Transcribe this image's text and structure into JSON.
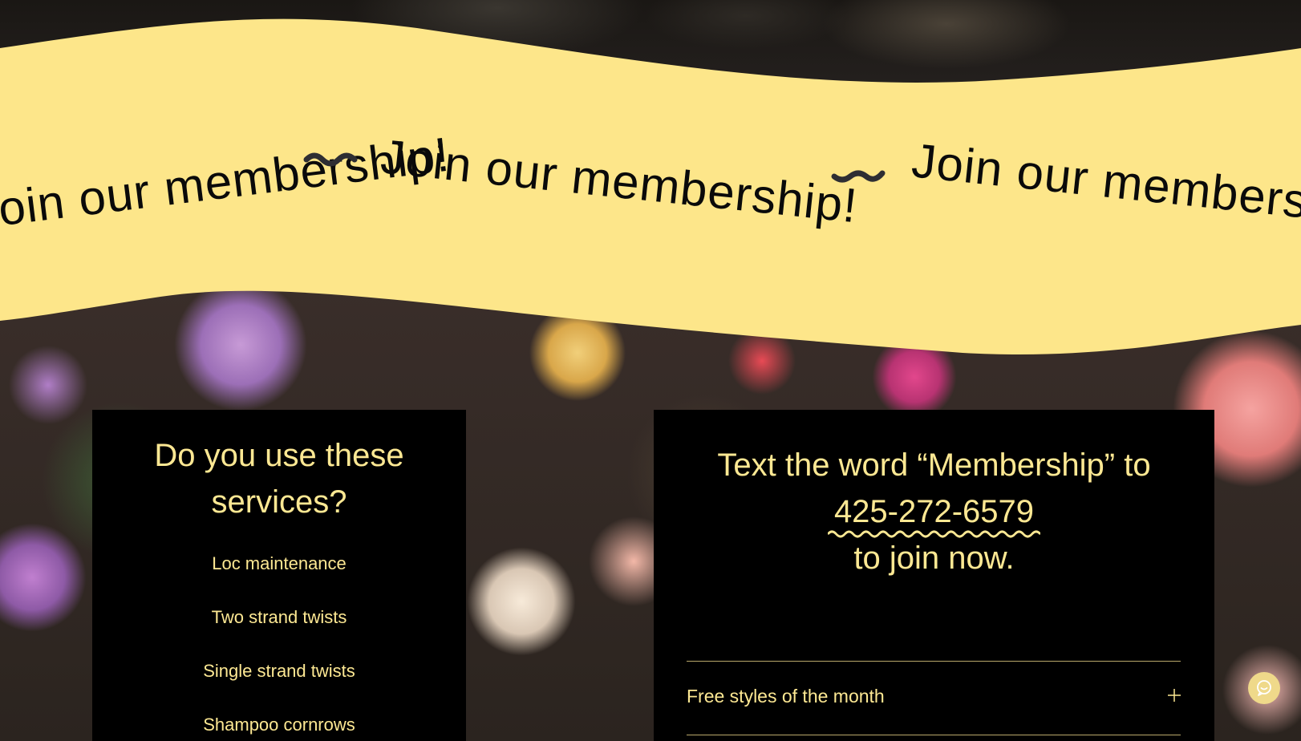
{
  "banner": {
    "text": "Join our membership!",
    "background_color": "#fde68a",
    "separator_icon": "tilde-icon"
  },
  "services": {
    "title_line1": "Do you use these",
    "title_line2": "services?",
    "items": [
      "Loc maintenance",
      "Two strand twists",
      "Single strand twists",
      "Shampoo cornrows"
    ]
  },
  "membership": {
    "cta_prefix": "Text  the word “Membership” to",
    "phone": "425-272-6579",
    "cta_suffix": "to join now.",
    "accordion": [
      {
        "label": "Free styles of the month",
        "icon": "plus-icon"
      }
    ]
  },
  "chat": {
    "icon": "chat-bubble-icon",
    "color": "#efd98a"
  },
  "colors": {
    "accent": "#fde893",
    "card_background": "#000000",
    "text_dark": "#0a0a0a"
  }
}
